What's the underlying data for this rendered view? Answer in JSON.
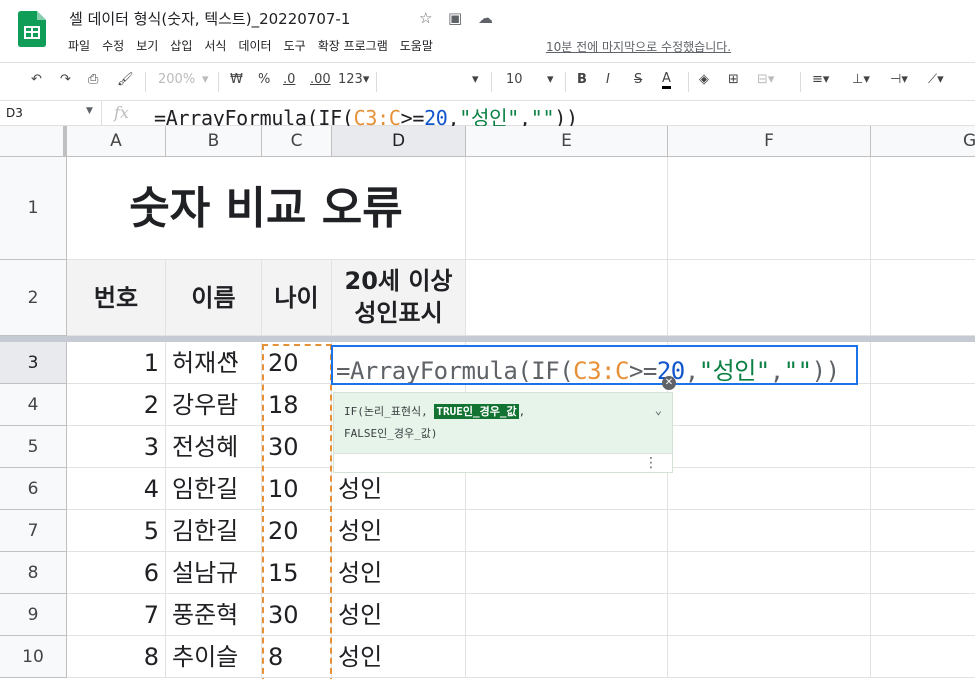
{
  "app": {
    "doc_title": "셀 데이터 형식(숫자, 텍스트)_20220707-1",
    "last_edit": "10분 전에 마지막으로 수정했습니다.",
    "menu": [
      "파일",
      "수정",
      "보기",
      "삽입",
      "서식",
      "데이터",
      "도구",
      "확장 프로그램",
      "도움말"
    ]
  },
  "toolbar": {
    "zoom": "200%",
    "currency": "₩",
    "percent": "%",
    "dec_less": ".0",
    "dec_more": ".00",
    "format_more": "123▾",
    "font_size": "10",
    "bold": "B",
    "italic": "I",
    "strike": "S",
    "text_color": "A"
  },
  "formula_bar": {
    "name_box": "D3",
    "fx": "fx",
    "p1": "=ArrayFormula(IF(",
    "p2": "C3:C",
    "p3": ">=",
    "p4": "20",
    "p5": ",",
    "p6": "\"성인\"",
    "p7": ",",
    "p8": "\"\"",
    "p9": "))"
  },
  "columns": [
    "A",
    "B",
    "C",
    "D",
    "E",
    "F",
    "G"
  ],
  "rows": [
    "1",
    "2",
    "3",
    "4",
    "5",
    "6",
    "7",
    "8",
    "9",
    "10"
  ],
  "sheet": {
    "title": "숫자 비교 오류",
    "headers": {
      "a": "번호",
      "b": "이름",
      "c": "나이",
      "d1": "20세 이상",
      "d2": "성인표시"
    },
    "data": [
      {
        "no": "1",
        "name": "허재신",
        "age": "20",
        "adult": ""
      },
      {
        "no": "2",
        "name": "강우람",
        "age": "18",
        "adult": ""
      },
      {
        "no": "3",
        "name": "전성혜",
        "age": "30",
        "adult": ""
      },
      {
        "no": "4",
        "name": "임한길",
        "age": "10",
        "adult": "성인"
      },
      {
        "no": "5",
        "name": "김한길",
        "age": "20",
        "adult": "성인"
      },
      {
        "no": "6",
        "name": "설남규",
        "age": "15",
        "adult": "성인"
      },
      {
        "no": "7",
        "name": "풍준혁",
        "age": "30",
        "adult": "성인"
      },
      {
        "no": "8",
        "name": "추이슬",
        "age": "8",
        "adult": "성인"
      }
    ]
  },
  "tooltip": {
    "line1_a": "IF(논리_표현식, ",
    "line1_b": "TRUE인_경우_값",
    "line1_c": ",",
    "line2": "FALSE인_경우_값)"
  },
  "colors": {
    "accent": "#1a73e8",
    "range_ref": "#e69138",
    "string": "#0b8043",
    "number": "#1155cc"
  }
}
